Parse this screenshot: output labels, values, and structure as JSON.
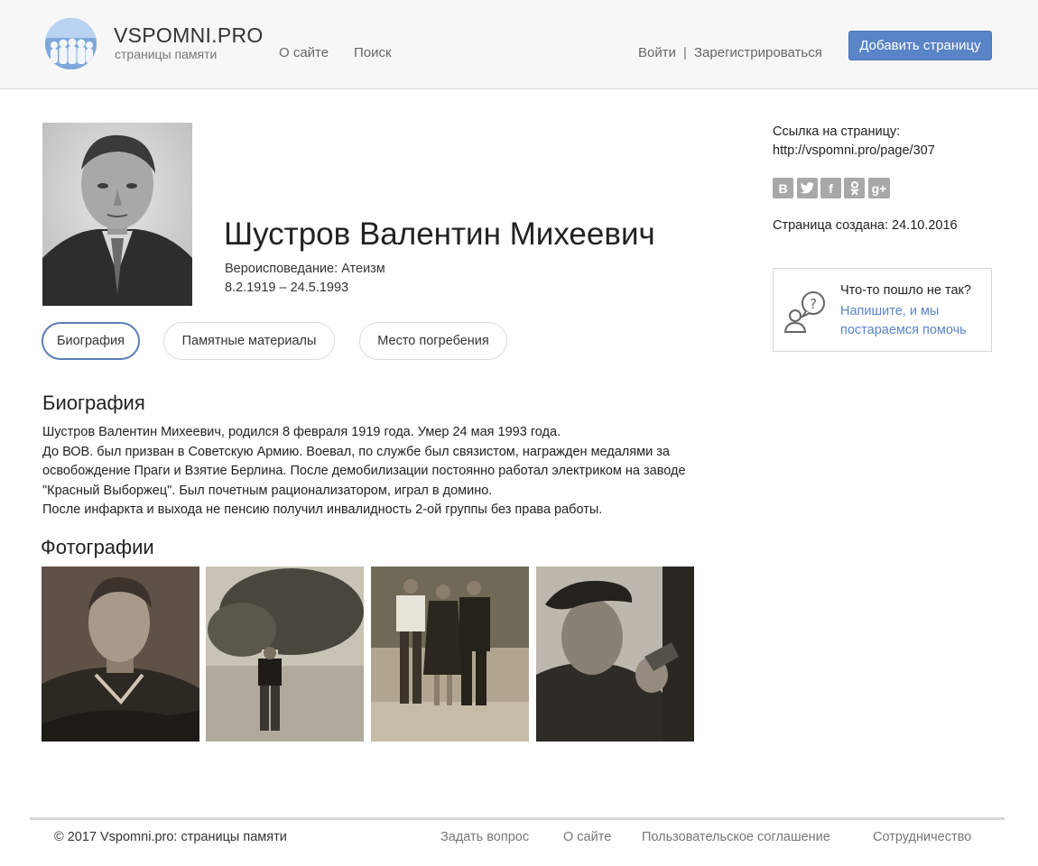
{
  "header": {
    "brand_title": "VSPOMNI.PRO",
    "brand_subtitle": "страницы памяти",
    "nav": [
      "О сайте",
      "Поиск"
    ],
    "login": "Войти",
    "separator": "|",
    "register": "Зарегистрироваться",
    "add_page": "Добавить страницу"
  },
  "person": {
    "name": "Шустров Валентин Михеевич",
    "religion": "Вероисповедание: Атеизм",
    "dates": "8.2.1919 – 24.5.1993"
  },
  "tabs": [
    {
      "label": "Биография",
      "active": true
    },
    {
      "label": "Памятные материалы",
      "active": false
    },
    {
      "label": "Место погребения",
      "active": false
    }
  ],
  "biography": {
    "title": "Биография",
    "lines": [
      "Шустров Валентин Михеевич, родился 8 февраля 1919 года. Умер 24 мая 1993 года.",
      "До ВОВ. был призван в Советскую Армию. Воевал, по службе был связистом, награжден медалями за",
      "освобождение Праги и Взятие Берлина. После демобилизации постоянно работал электриком на заводе",
      "\"Красный Выборжец\". Был почетным рационализатором, играл в домино.",
      "После инфаркта и выхода не пенсию получил инвалидность 2-ой группы без права работы."
    ]
  },
  "photos": {
    "title": "Фотографии"
  },
  "sidebar": {
    "link_label": "Ссылка на страницу:",
    "link_url": "http://vspomni.pro/page/307",
    "social": [
      {
        "icon": "vk-icon",
        "glyph": "В"
      },
      {
        "icon": "twitter-icon",
        "glyph": "t"
      },
      {
        "icon": "facebook-icon",
        "glyph": "f"
      },
      {
        "icon": "odnoklassniki-icon",
        "glyph": "ok"
      },
      {
        "icon": "google-plus-icon",
        "glyph": "g+"
      }
    ],
    "created": "Страница создана: 24.10.2016",
    "help_question": "Что-то пошло не так?",
    "help_link": "Напишите, и мы постараемся помочь"
  },
  "footer": {
    "copyright": "© 2017 Vspomni.pro: страницы памяти",
    "links": [
      "Задать вопрос",
      "О сайте",
      "Пользовательское соглашение",
      "Сотрудничество"
    ]
  },
  "colors": {
    "accent": "#5a84c8",
    "header_bg": "#f7f7f7",
    "social_gray": "#a8a8a8"
  }
}
